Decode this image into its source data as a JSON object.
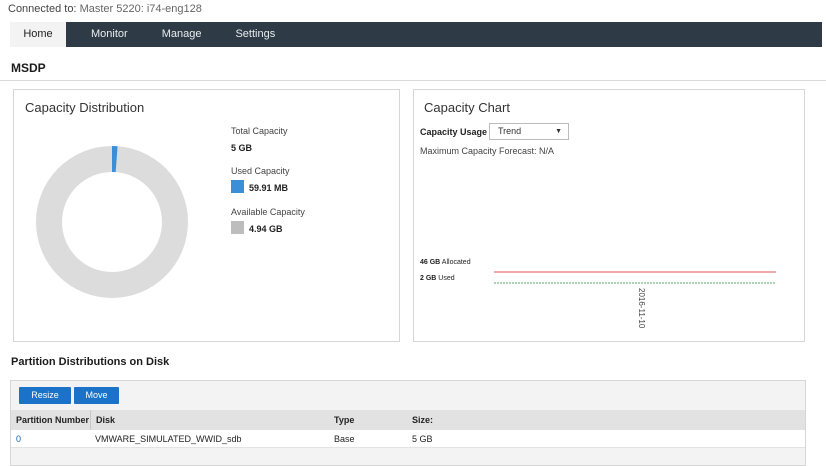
{
  "connection": {
    "label": "Connected to:",
    "value": "Master 5220: i74-eng128"
  },
  "nav": {
    "tabs": [
      {
        "label": "Home",
        "active": true
      },
      {
        "label": "Monitor"
      },
      {
        "label": "Manage"
      },
      {
        "label": "Settings"
      }
    ]
  },
  "page": {
    "title": "MSDP"
  },
  "capacity_distribution": {
    "title": "Capacity Distribution",
    "total_label": "Total Capacity",
    "total_value": "5 GB",
    "used_label": "Used Capacity",
    "used_value": "59.91 MB",
    "available_label": "Available Capacity",
    "available_value": "4.94 GB",
    "used_fraction": 0.0117,
    "colors": {
      "used": "#3b8fd9",
      "available": "#dcdcdc"
    }
  },
  "capacity_chart": {
    "title": "Capacity Chart",
    "usage_label": "Capacity Usage",
    "usage_select": "Trend",
    "forecast": "Maximum Capacity Forecast: N/A",
    "allocated_value": "46 GB",
    "allocated_label": "Allocated",
    "used_value": "2 GB",
    "used_label": "Used",
    "date": "2016-11-10",
    "colors": {
      "allocated": "#e05252",
      "used": "#5aa86a"
    }
  },
  "partitions": {
    "title": "Partition Distributions on Disk",
    "resize_label": "Resize",
    "move_label": "Move",
    "columns": [
      "Partition Number",
      "Disk",
      "Type",
      "Size:"
    ],
    "rows": [
      {
        "number": "0",
        "disk": "VMWARE_SIMULATED_WWID_sdb",
        "type": "Base",
        "size": "5 GB"
      }
    ]
  }
}
